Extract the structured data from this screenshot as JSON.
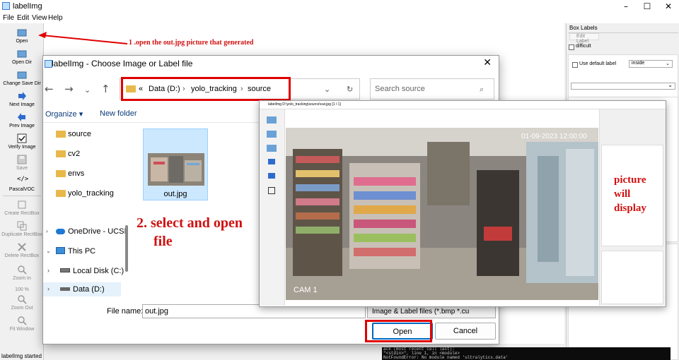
{
  "window": {
    "title": "labelImg"
  },
  "menu": [
    "File",
    "Edit",
    "View",
    "Help"
  ],
  "toolbar": {
    "items": [
      {
        "label": "Open",
        "icon": "open-folder-icon",
        "enabled": true
      },
      {
        "label": "Open Dir",
        "icon": "open-dir-icon",
        "enabled": true
      },
      {
        "label": "Change Save Dir",
        "icon": "change-save-dir-icon",
        "enabled": true
      },
      {
        "label": "Next Image",
        "icon": "next-arrow-icon",
        "enabled": true
      },
      {
        "label": "Prev Image",
        "icon": "prev-arrow-icon",
        "enabled": true
      },
      {
        "label": "Verify Image",
        "icon": "verify-check-icon",
        "enabled": true
      },
      {
        "label": "Save",
        "icon": "save-icon",
        "enabled": false
      },
      {
        "label": "PascalVOC",
        "icon": "format-code-icon",
        "enabled": true
      },
      {
        "label": "Create RectBox",
        "icon": "create-rectbox-icon",
        "enabled": false
      },
      {
        "label": "Duplicate RectBox",
        "icon": "duplicate-rectbox-icon",
        "enabled": false
      },
      {
        "label": "Delete RectBox",
        "icon": "delete-rectbox-icon",
        "enabled": false
      },
      {
        "label": "Zoom In",
        "icon": "zoom-in-icon",
        "enabled": false
      },
      {
        "label": "100 %",
        "icon": "",
        "enabled": false
      },
      {
        "label": "Zoom Out",
        "icon": "zoom-out-icon",
        "enabled": false
      },
      {
        "label": "Fit Window",
        "icon": "fit-window-icon",
        "enabled": false
      }
    ]
  },
  "right_dock": {
    "title": "Box Labels",
    "edit_label": "Edit Label",
    "difficult": "difficult",
    "use_default_label": "Use default label",
    "default_label_value": "inside"
  },
  "status": "labelImg started",
  "terminal": [
    "ack (most recent call last):",
    "\"<stdin>\", line 1, in <module>",
    "NotFoundError: No module named 'ultralytics.data'"
  ],
  "dialog": {
    "title": "labelImg - Choose Image or Label file",
    "breadcrumb": [
      "«",
      "Data (D:)",
      "yolo_tracking",
      "source"
    ],
    "search_placeholder": "Search source",
    "organize": "Organize ▾",
    "new_folder": "New folder",
    "folders": [
      "source",
      "cv2",
      "envs",
      "yolo_tracking"
    ],
    "nav": [
      {
        "label": "OneDrive - UCSI",
        "icon": "cloud-icon"
      },
      {
        "label": "This PC",
        "icon": "computer-icon"
      },
      {
        "label": "Local Disk (C:)",
        "icon": "drive-icon"
      },
      {
        "label": "Data (D:)",
        "icon": "drive-icon"
      }
    ],
    "file": {
      "name": "out.jpg"
    },
    "filename_label": "File name:",
    "filename_value": "out.jpg",
    "filetype": "Image & Label files (*.bmp *.cu",
    "open_button": "Open",
    "cancel_button": "Cancel"
  },
  "annotations": {
    "step1": "1 .open the out.jpg picture that generated",
    "step2_line1": "2. select and open",
    "step2_line2": "file",
    "display_lines": [
      "picture",
      "will",
      "display"
    ]
  },
  "overlay": {
    "title": "labelImg D:\\yolo_tracking\\source\\out.jpg [1 / 1]",
    "timestamp": "01-09-2023  12:00:00",
    "cam_label": "CAM 1"
  },
  "colors": {
    "annotation_red": "#d01010",
    "accent_blue": "#0067c0"
  }
}
